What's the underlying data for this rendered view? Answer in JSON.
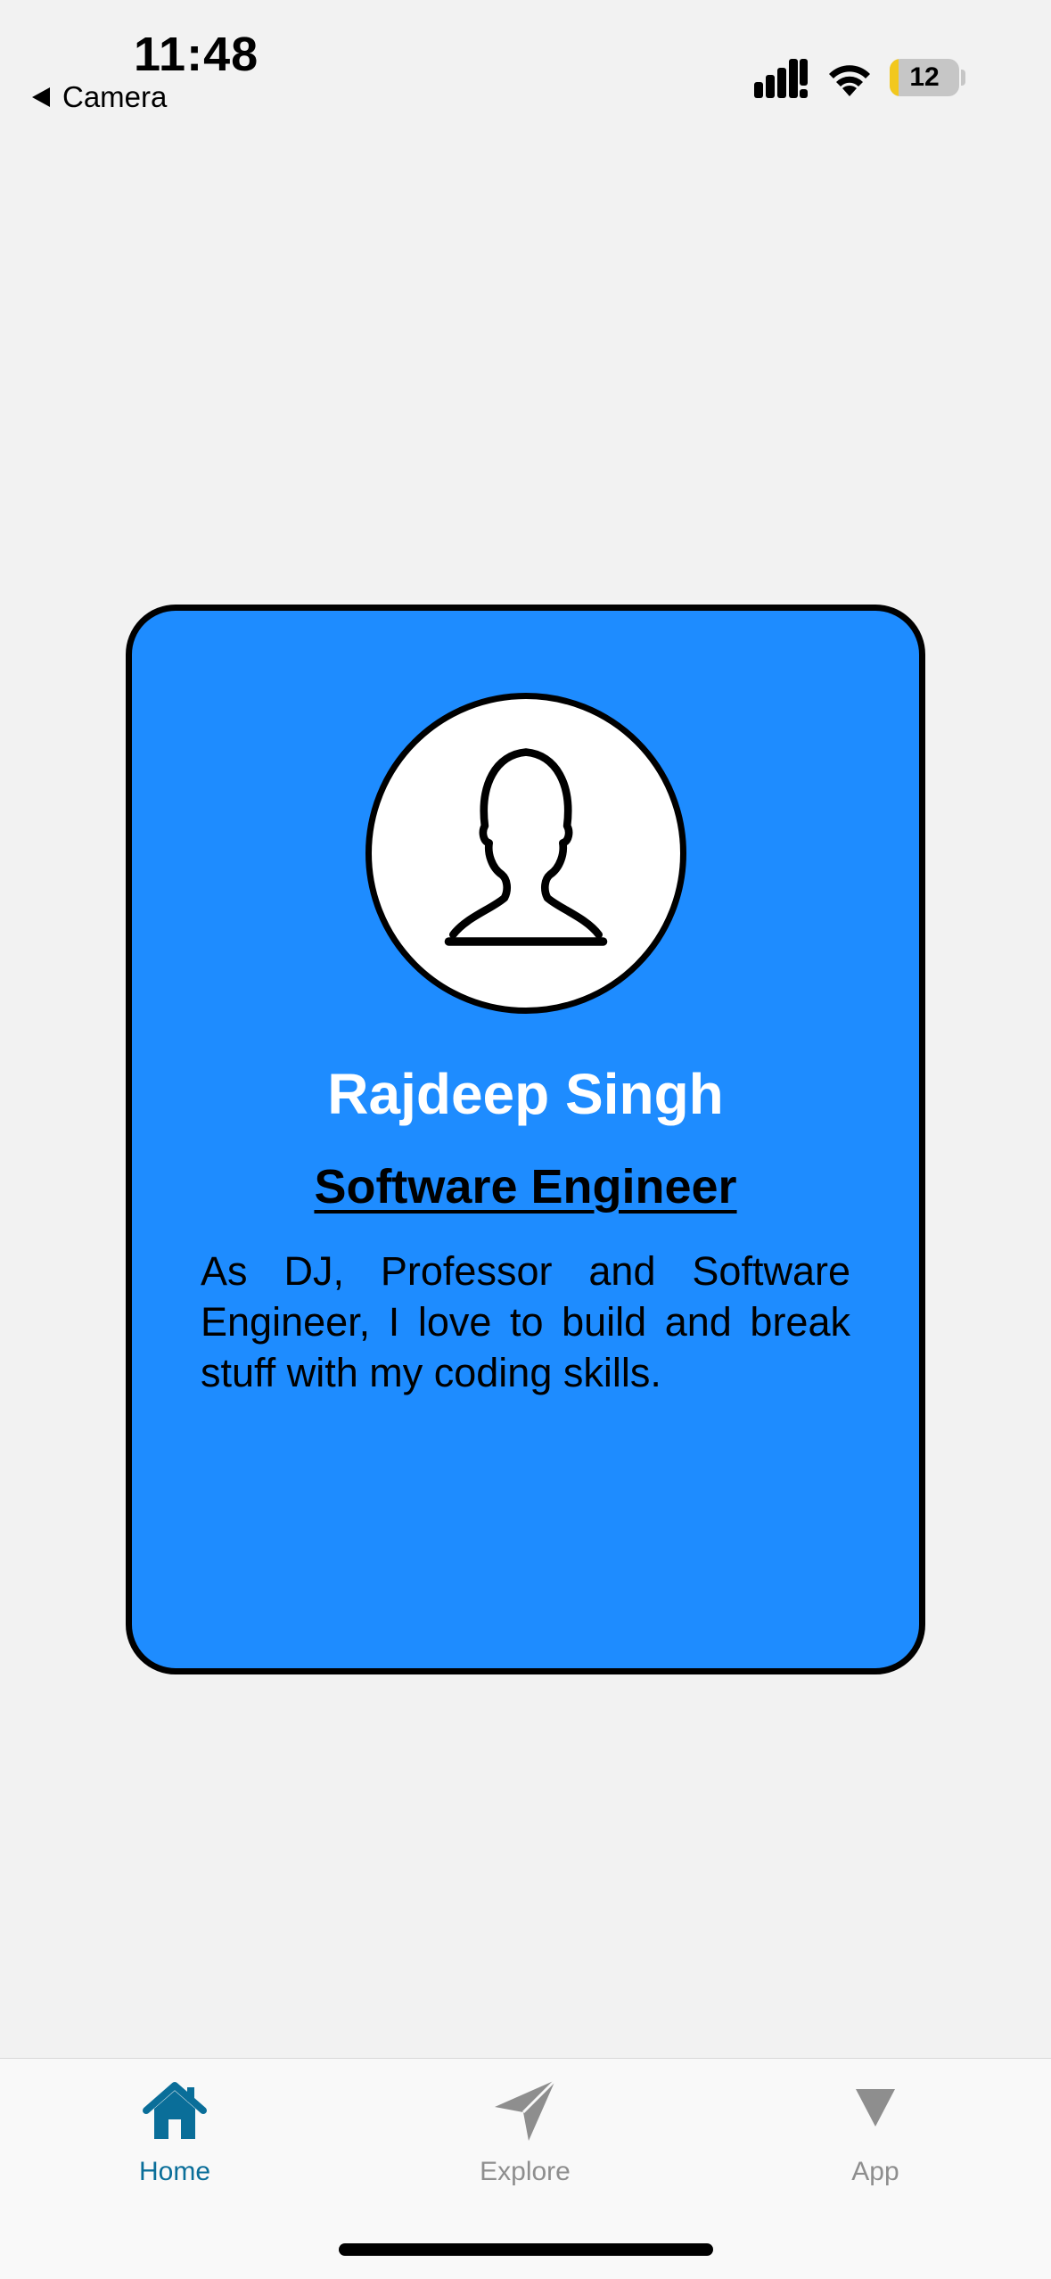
{
  "status_bar": {
    "time": "11:48",
    "back_label": "Camera",
    "battery_percent": "12",
    "battery_color": "#f2c81e"
  },
  "profile_card": {
    "background_color": "#1e8cff",
    "avatar_icon": "person-silhouette-icon",
    "name": "Rajdeep Singh",
    "role": "Software Engineer",
    "bio": "As DJ, Professor and Software Engineer, I love to build and break stuff with my coding skills."
  },
  "tab_bar": {
    "active_color": "#0a6e99",
    "inactive_color": "#8e8e8e",
    "tabs": [
      {
        "label": "Home",
        "icon": "home-icon",
        "active": true
      },
      {
        "label": "Explore",
        "icon": "paper-plane-icon",
        "active": false
      },
      {
        "label": "App",
        "icon": "triangle-down-icon",
        "active": false
      }
    ]
  }
}
